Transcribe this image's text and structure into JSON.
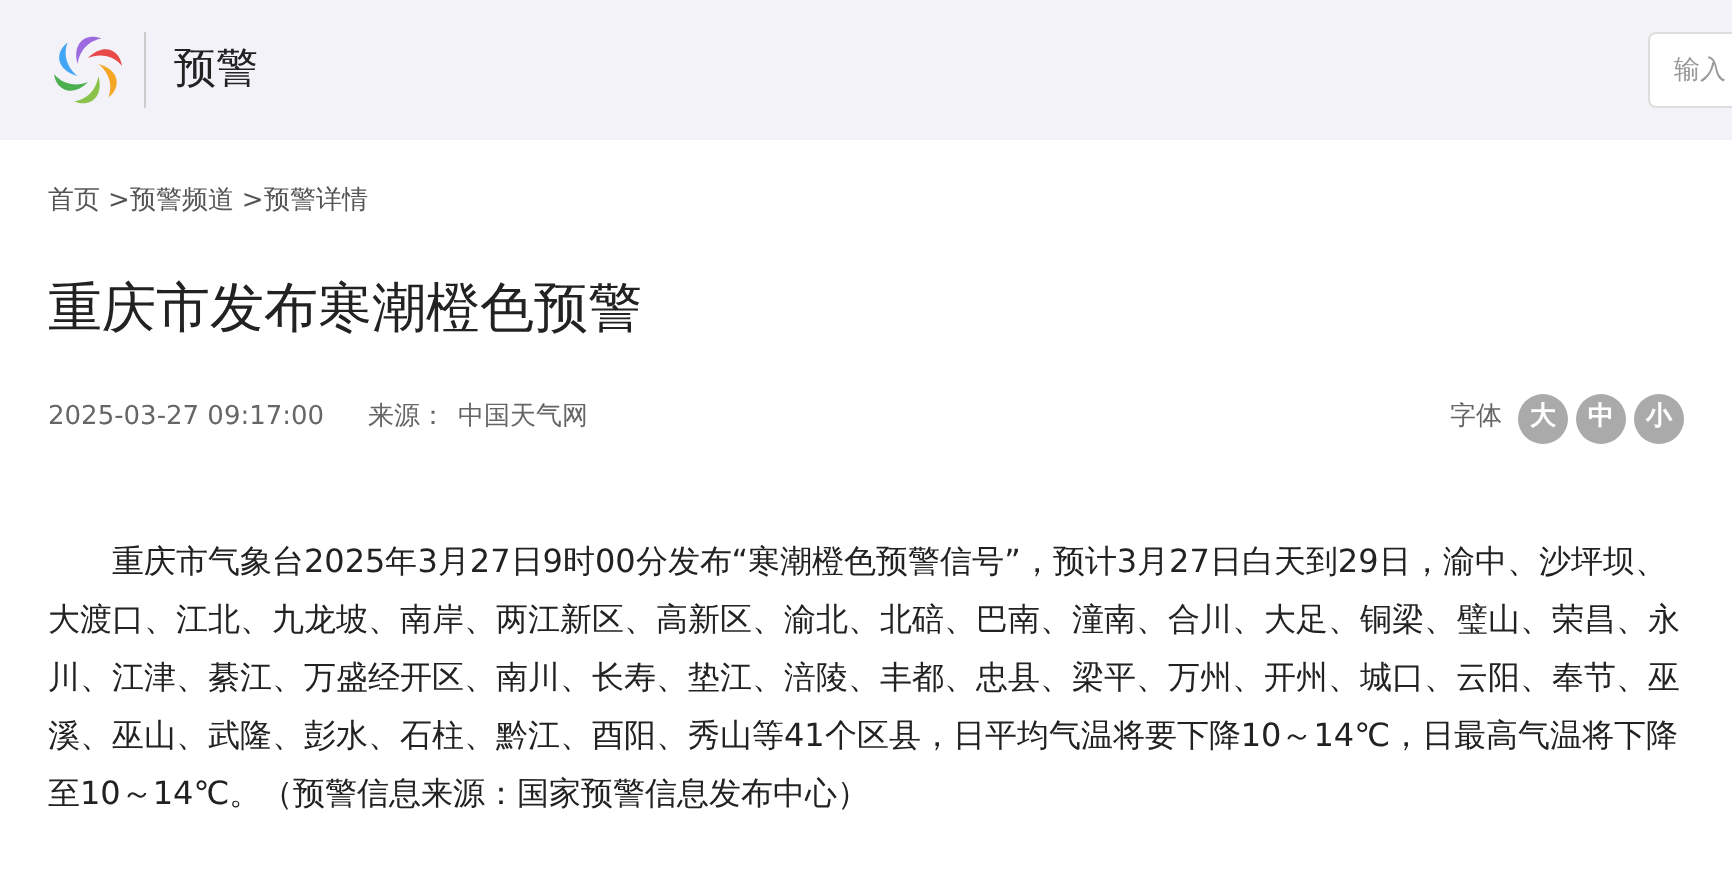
{
  "header": {
    "title": "预警",
    "search": {
      "placeholder": "输入"
    }
  },
  "breadcrumb": [
    {
      "label": "首页"
    },
    {
      "label": ">预警频道"
    },
    {
      "label": ">预警详情"
    }
  ],
  "article": {
    "title": "重庆市发布寒潮橙色预警",
    "time": "2025-03-27 09:17:00",
    "source_label": "来源：",
    "source": "中国天气网",
    "font_label": "字体",
    "font_sizes": [
      "大",
      "中",
      "小"
    ],
    "body": "重庆市气象台2025年3月27日9时00分发布“寒潮橙色预警信号”，预计3月27日白天到29日，渝中、沙坪坝、大渡口、江北、九龙坡、南岸、两江新区、高新区、渝北、北碚、巴南、潼南、合川、大足、铜梁、璧山、荣昌、永川、江津、綦江、万盛经开区、南川、长寿、垫江、涪陵、丰都、忠县、梁平、万州、开州、城口、云阳、奉节、巫溪、巫山、武隆、彭水、石柱、黔江、酉阳、秀山等41个区县，日平均气温将要下降10～14℃，日最高气温将下降至10～14℃。（预警信息来源：国家预警信息发布中心）"
  }
}
